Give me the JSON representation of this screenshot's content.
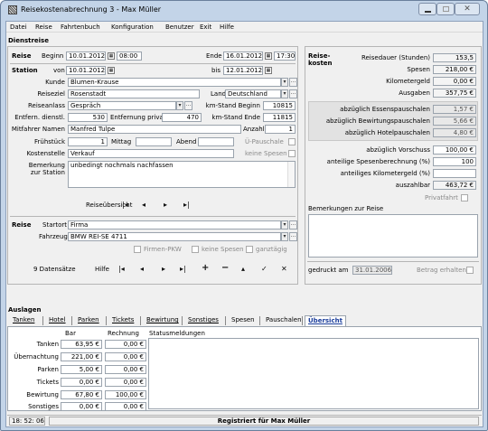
{
  "window": {
    "title": "Reisekostenabrechnung 3 - Max Müller"
  },
  "menu": [
    "Datei",
    "Reise",
    "Fahrtenbuch",
    "Konfiguration",
    "Benutzer",
    "Exit",
    "Hilfe"
  ],
  "dienstreise": {
    "heading": "Dienstreise",
    "reise_label": "Reise",
    "beginn_label": "Beginn",
    "beginn_date": "10.01.2012",
    "beginn_time": "08:00",
    "ende_label": "Ende",
    "ende_date": "16.01.2012",
    "ende_time": "17:30",
    "station_label": "Station",
    "von_label": "von",
    "von_date": "10.01.2012",
    "bis_label": "bis",
    "bis_date": "12.01.2012",
    "kunde_label": "Kunde",
    "kunde_value": "Blumen-Krause",
    "reiseziel_label": "Reiseziel",
    "reiseziel_value": "Rosenstadt",
    "land_label": "Land",
    "land_value": "Deutschland",
    "reiseanlass_label": "Reiseanlass",
    "reiseanlass_value": "Gespräch",
    "km_beginn_label": "km-Stand Beginn",
    "km_beginn_value": "10815",
    "entf_dienstl_label": "Entfern. dienstl.",
    "entf_dienstl_value": "530",
    "entf_privat_label": "Entfernung privat",
    "entf_privat_value": "470",
    "km_ende_label": "km-Stand Ende",
    "km_ende_value": "11815",
    "mitfahrer_label": "Mitfahrer Namen",
    "mitfahrer_value": "Manfred Tulpe",
    "anzahl_label": "Anzahl",
    "anzahl_value": "1",
    "fruehstueck_label": "Frühstück",
    "fruehstueck_value": "1",
    "mittag_label": "Mittag",
    "mittag_value": "",
    "abend_label": "Abend",
    "abend_value": "",
    "upauschale_label": "Ü-Pauschale",
    "kostenstelle_label": "Kostenstelle",
    "kostenstelle_value": "Verkauf",
    "keine_spesen_label": "keine Spesen",
    "bemerkung_label": "Bemerkung\nzur Station",
    "bemerkung_value": "unbedingt nochmals nachfassen",
    "reiseuebersicht_label": "Reiseübersicht"
  },
  "fahrt": {
    "reise_label": "Reise",
    "startort_label": "Startort",
    "startort_value": "Firma",
    "fahrzeug_label": "Fahrzeug",
    "fahrzeug_value": "BMW REI-SE 4711",
    "firmen_pkw": "Firmen-PKW",
    "keine_spesen": "keine Spesen",
    "ganztaegig": "ganztägig"
  },
  "records": {
    "count_label": "9 Datensätze",
    "hilfe_label": "Hilfe"
  },
  "summary": {
    "heading": "Reise-\nkosten",
    "reisedauer_label": "Reisedauer (Stunden)",
    "reisedauer_value": "153,5",
    "spesen_label": "Spesen",
    "spesen_value": "218,00 €",
    "kilometergeld_label": "Kilometergeld",
    "kilometergeld_value": "0,00 €",
    "ausgaben_label": "Ausgaben",
    "ausgaben_value": "357,75 €",
    "essen_label": "abzüglich Essenspauschalen",
    "essen_value": "1,57 €",
    "bewirtung_label": "abzüglich Bewirtungspauschalen",
    "bewirtung_value": "5,66 €",
    "hotel_label": "abzüglich Hotelpauschalen",
    "hotel_value": "4,80 €",
    "vorschuss_label": "abzüglich Vorschuss",
    "vorschuss_value": "100,00 €",
    "spesen_anteil_label": "anteilige Spesenberechnung (%)",
    "spesen_anteil_value": "100",
    "km_anteil_label": "anteiliges Kilometergeld (%)",
    "km_anteil_value": "",
    "auszahlbar_label": "auszahlbar",
    "auszahlbar_value": "463,72 €",
    "privatfahrt_label": "Privatfahrt",
    "bemerkungen_label": "Bemerkungen zur Reise",
    "gedruckt_label": "gedruckt am",
    "gedruckt_value": "31.01.2006",
    "betrag_label": "Betrag erhalten"
  },
  "auslagen": {
    "heading": "Auslagen",
    "tabs": [
      "Tanken",
      "Hotel",
      "Parken",
      "Tickets",
      "Bewirtung",
      "Sonstiges",
      "Spesen",
      "Pauschalen",
      "Übersicht"
    ],
    "col_bar": "Bar",
    "col_rechnung": "Rechnung",
    "col_status": "Statusmeldungen",
    "rows": [
      {
        "label": "Tanken",
        "bar": "63,95 €",
        "rechnung": "0,00 €"
      },
      {
        "label": "Übernachtung",
        "bar": "221,00 €",
        "rechnung": "0,00 €"
      },
      {
        "label": "Parken",
        "bar": "5,00 €",
        "rechnung": "0,00 €"
      },
      {
        "label": "Tickets",
        "bar": "0,00 €",
        "rechnung": "0,00 €"
      },
      {
        "label": "Bewirtung",
        "bar": "67,80 €",
        "rechnung": "100,00 €"
      },
      {
        "label": "Sonstiges",
        "bar": "0,00 €",
        "rechnung": "0,00 €"
      }
    ]
  },
  "statusbar": {
    "time": "18: 52: 06",
    "registered": "Registriert für Max Müller"
  },
  "icons": {
    "app": "app-icon",
    "minimize": "minimize-icon",
    "maximize": "maximize-icon",
    "close": "close-icon"
  }
}
